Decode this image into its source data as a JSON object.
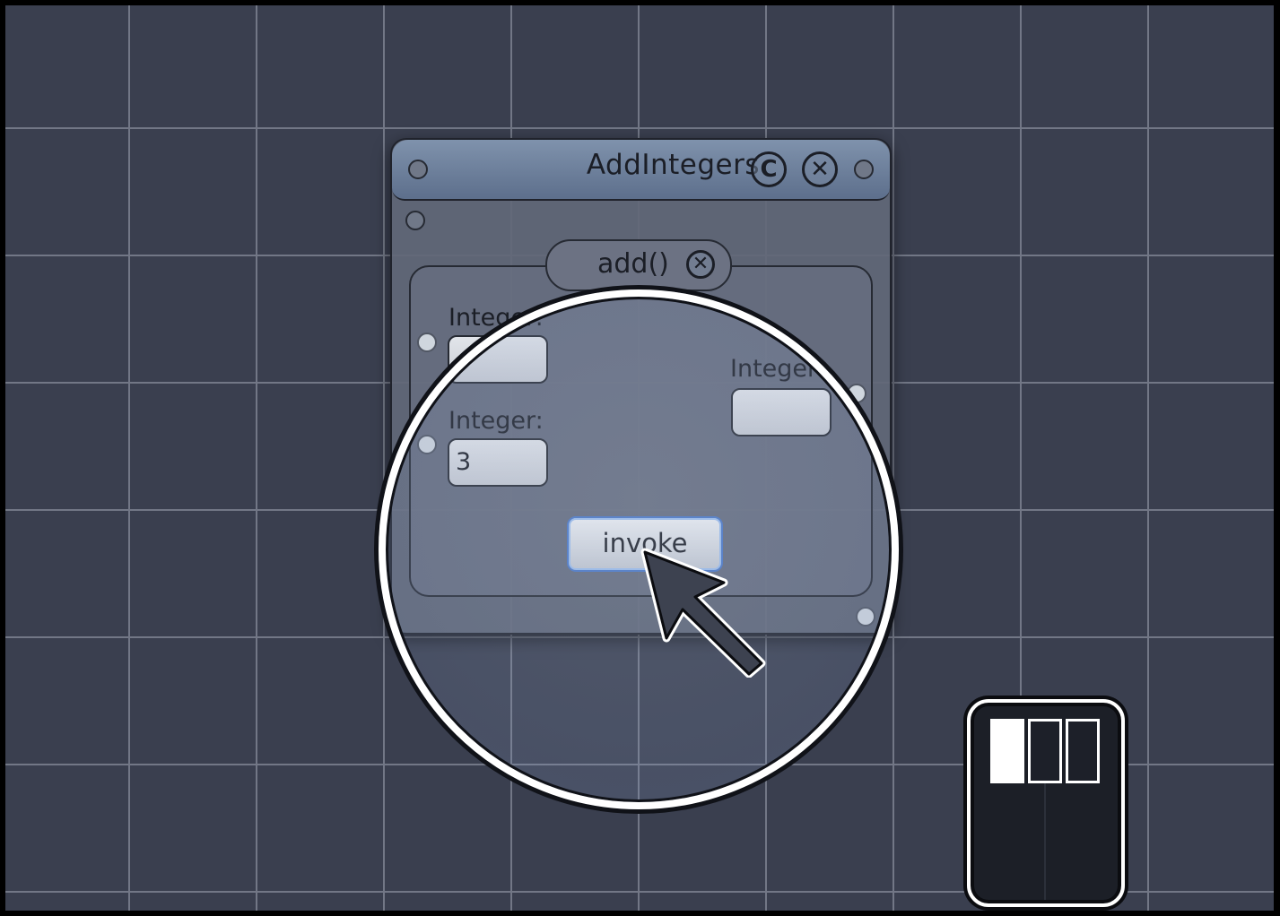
{
  "object_window": {
    "title": "AddIntegers",
    "compile_button_glyph": "C",
    "close_button_glyph": "✕"
  },
  "method": {
    "label": "add()",
    "close_glyph": "✕",
    "param1": {
      "label": "Integer:",
      "value": ""
    },
    "param2": {
      "label": "Integer:",
      "value": "3"
    },
    "result": {
      "label": "Integer:",
      "value": ""
    },
    "invoke_label": "invoke"
  },
  "minimap": {
    "slot_count": 3,
    "active_slot": 1
  },
  "icons": {
    "cursor": "arrow-cursor-icon",
    "compile": "compile-icon",
    "close": "close-icon",
    "connector": "connector-icon"
  },
  "colors": {
    "canvas_background": "#3a3f4f",
    "grid_line": "#727786",
    "titlebar_top": "#7f92ac",
    "titlebar_bottom": "#5d6f8c",
    "invoke_focus": "#4a78c8",
    "magnifier_ring": "#ffffff"
  }
}
